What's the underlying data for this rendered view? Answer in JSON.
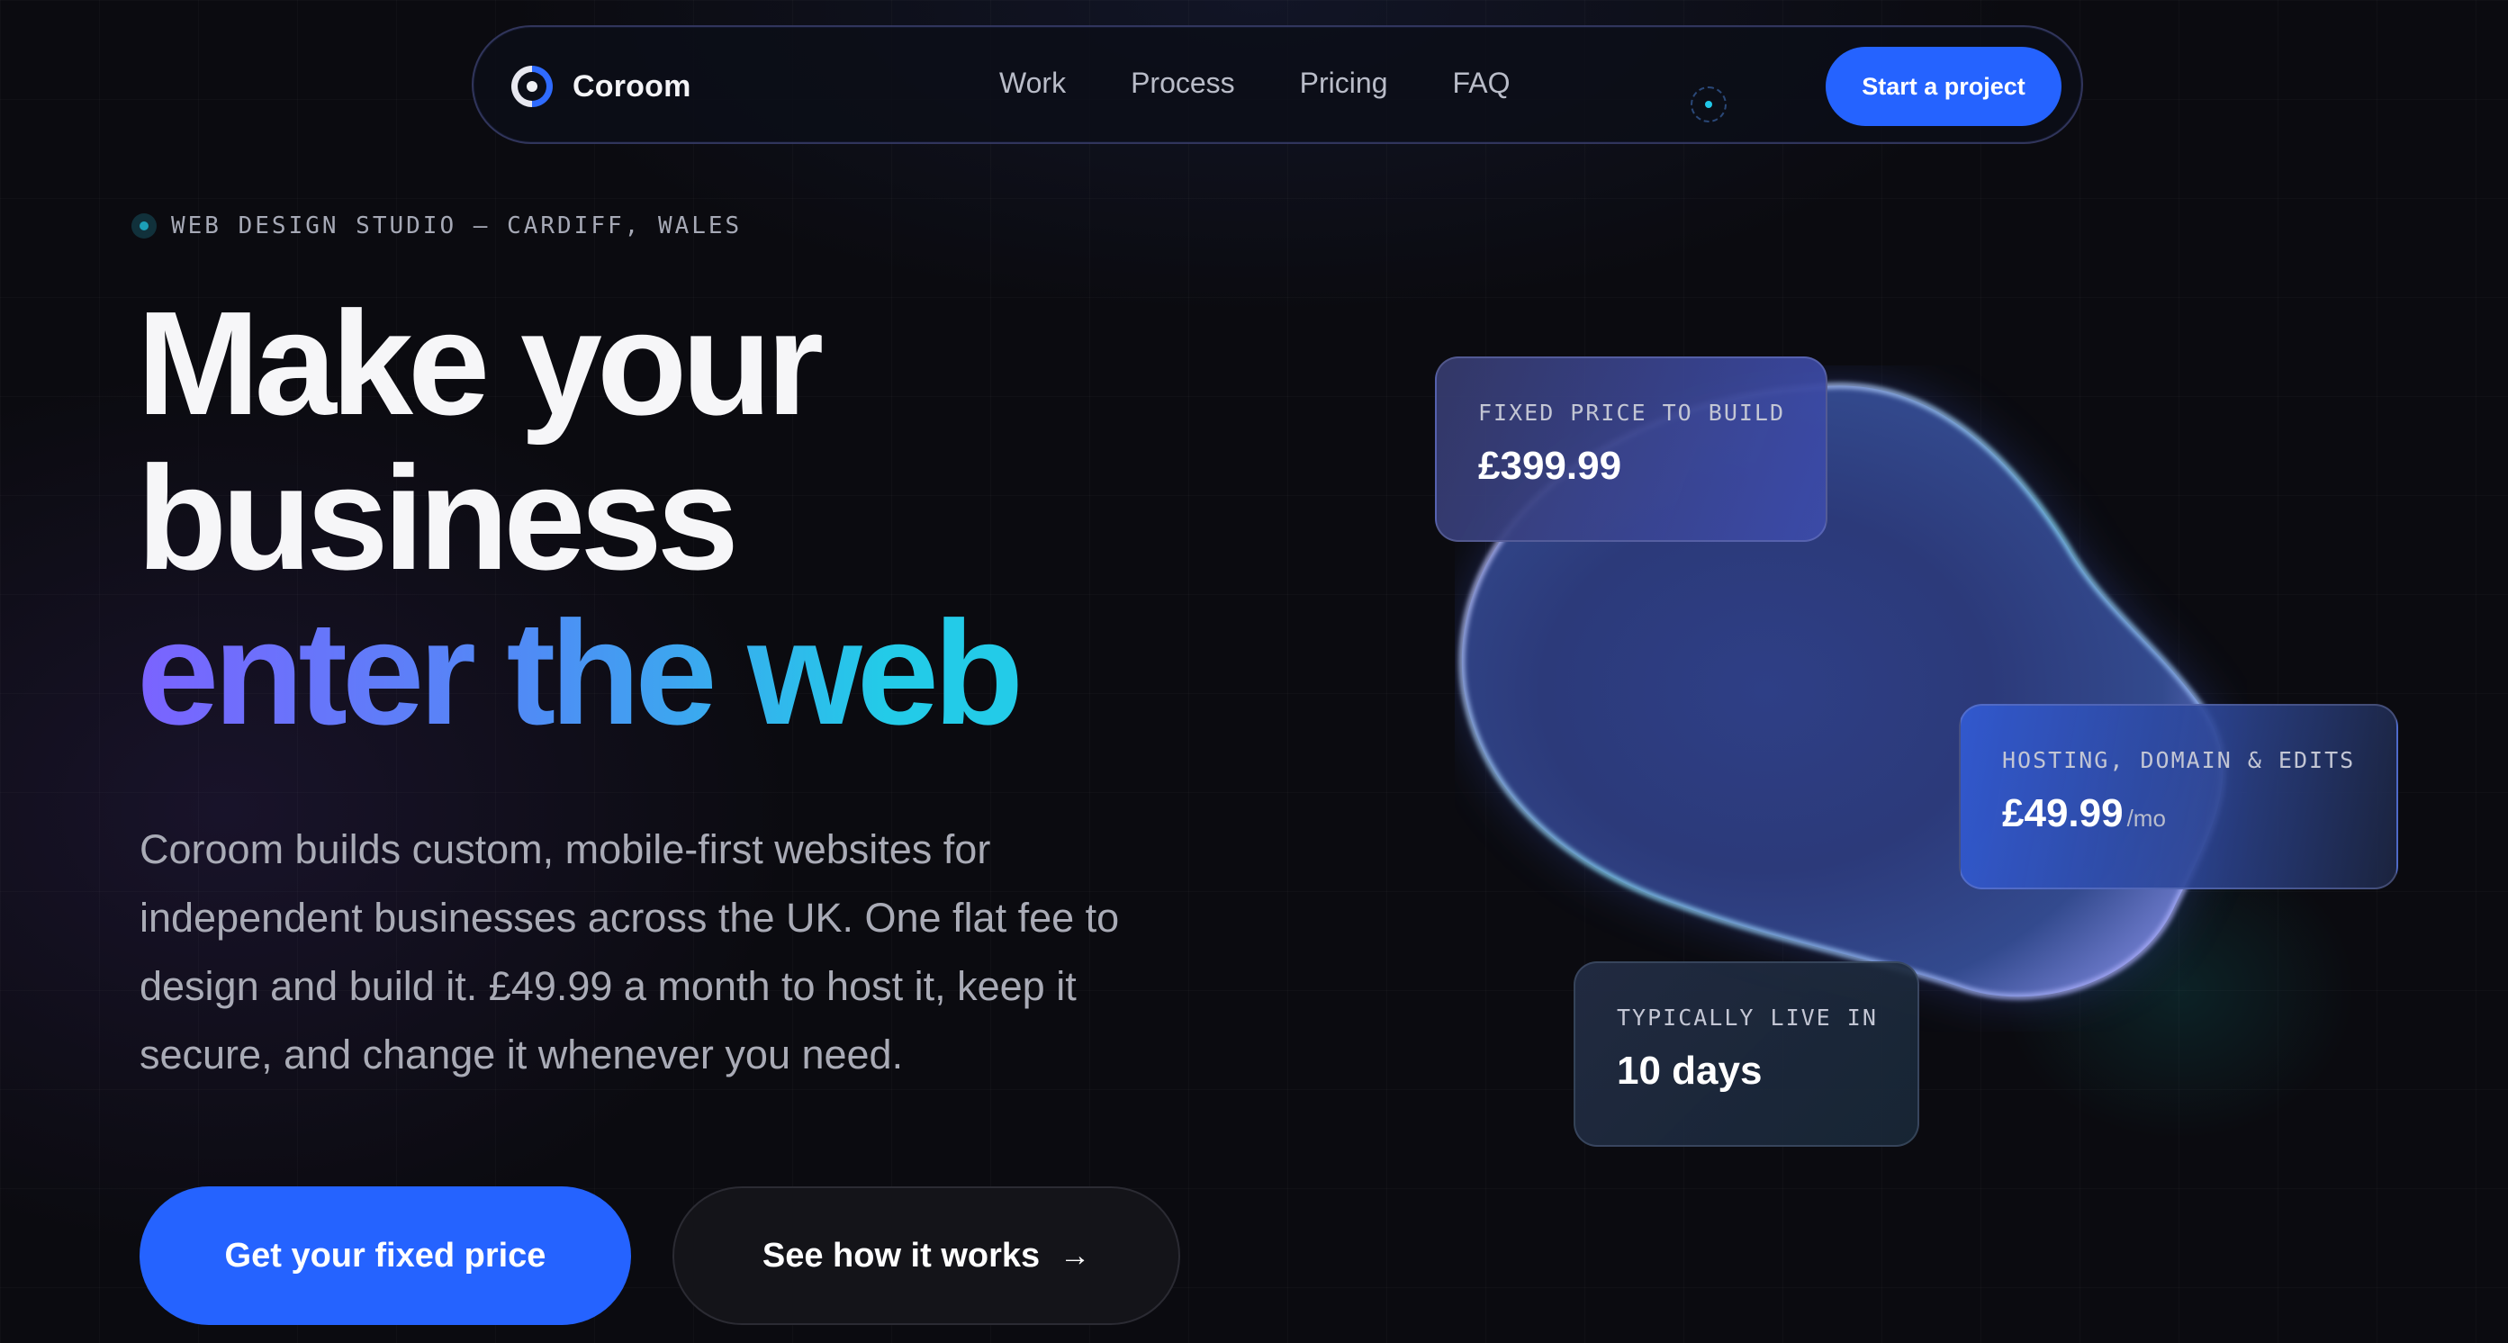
{
  "nav": {
    "brand": "Coroom",
    "links": [
      "Work",
      "Process",
      "Pricing",
      "FAQ"
    ],
    "cta": "Start a project"
  },
  "hero": {
    "eyebrow": "WEB DESIGN STUDIO — CARDIFF, WALES",
    "headline_line1": "Make your",
    "headline_line2": "business",
    "headline_line3": "enter the web",
    "description": "Coroom builds custom, mobile-first websites for independent businesses across the UK. One flat fee to design and build it. £49.99 a month to host it, keep it secure, and change it whenever you need.",
    "primary_cta": "Get your fixed price",
    "secondary_cta": "See how it works",
    "secondary_cta_icon": "arrow-right-icon"
  },
  "cards": {
    "build": {
      "label": "FIXED PRICE TO BUILD",
      "value": "£399.99"
    },
    "hosting": {
      "label": "HOSTING, DOMAIN & EDITS",
      "value": "£49.99",
      "unit": "/mo"
    },
    "live": {
      "label": "TYPICALLY LIVE IN",
      "value": "10 days"
    }
  },
  "colors": {
    "background": "#0b0b10",
    "accent": "#2563ff",
    "gradient_start": "#7b63ff",
    "gradient_end": "#23cbe8"
  }
}
